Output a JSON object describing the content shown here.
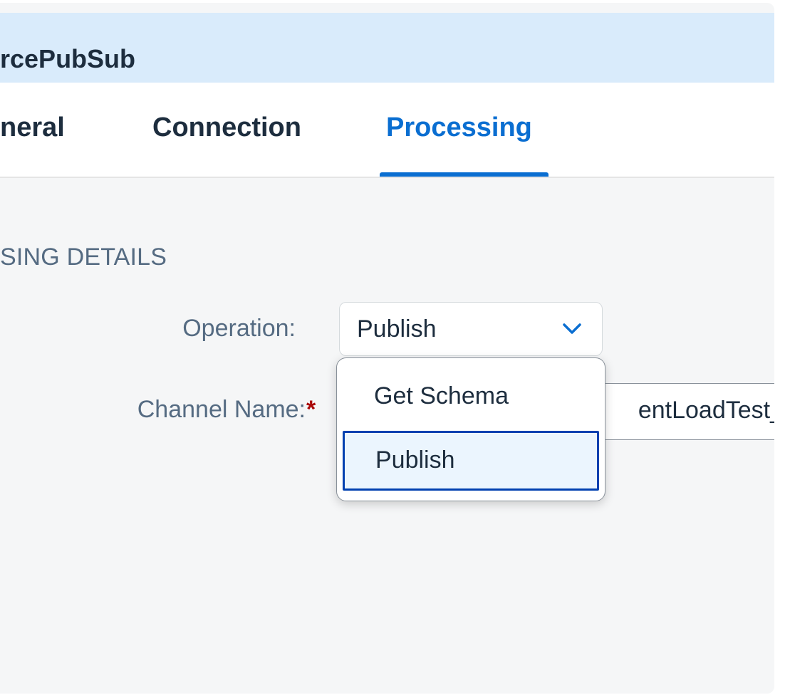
{
  "header": {
    "title": "rcePubSub"
  },
  "tabs": [
    {
      "label": "neral"
    },
    {
      "label": "Connection"
    },
    {
      "label": "Processing",
      "selected": true
    }
  ],
  "section": {
    "title": "SING DETAILS"
  },
  "form": {
    "operation_label": "Operation:",
    "operation_value": "Publish",
    "channel_label": "Channel Name:",
    "required_mark": "*",
    "channel_value": "entLoadTest_"
  },
  "dropdown": {
    "options": [
      {
        "label": "Get Schema"
      },
      {
        "label": "Publish",
        "selected": true
      }
    ]
  },
  "icons": {
    "select_arrow": "chevron-down-icon"
  },
  "colors": {
    "accent": "#0a6ed1",
    "header_bg": "#d9ebfb",
    "required": "#aa0808",
    "selected_option_bg": "#ebf5fe",
    "selected_option_border": "#0040b0"
  }
}
